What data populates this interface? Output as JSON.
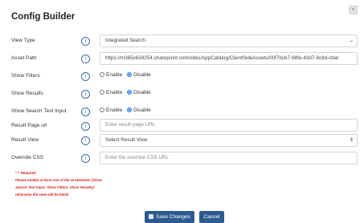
{
  "dialog": {
    "title": "Config Builder",
    "close_label": "×"
  },
  "rows": {
    "view_type": {
      "label": "View Type",
      "value": "Integrated Search"
    },
    "asset_path": {
      "label": "Asset Path",
      "value": "https://m365x634254.sharepoint.com/sites/AppCatalog/ClientSideAssets/00f7bcb7-98fe-43d7-8c8d-cbat"
    },
    "show_filters": {
      "label": "Show Filters",
      "enable": "Enable",
      "disable": "Disable",
      "selected": "Disable"
    },
    "show_results": {
      "label": "Show Results",
      "enable": "Enable",
      "disable": "Disable",
      "selected": "Disable"
    },
    "show_search_text_input": {
      "label": "Show Search Text Input",
      "enable": "Enable",
      "disable": "Disable",
      "selected": "Disable"
    },
    "result_page_url": {
      "label": "Result Page url",
      "placeholder": "Enter result page URL"
    },
    "result_view": {
      "label": "Result View",
      "value": "Select Result View"
    },
    "override_css": {
      "label": "Override CSS",
      "placeholder": "Enter the override CSS URL"
    }
  },
  "note": {
    "required": "* = Required",
    "message": "Please enable at least one of the UI elements (Show Search Text Input, Show Filters, Show Results) otherwise the view will be blank"
  },
  "buttons": {
    "save": "Save Changes",
    "cancel": "Cancel"
  },
  "icons": {
    "info": "info-icon",
    "save": "floppy-disk-icon",
    "close": "close-icon"
  },
  "colors": {
    "primary_button": "#2d5b8f",
    "note_text": "#d61f1f",
    "radio_checked": "#1a73e8"
  }
}
